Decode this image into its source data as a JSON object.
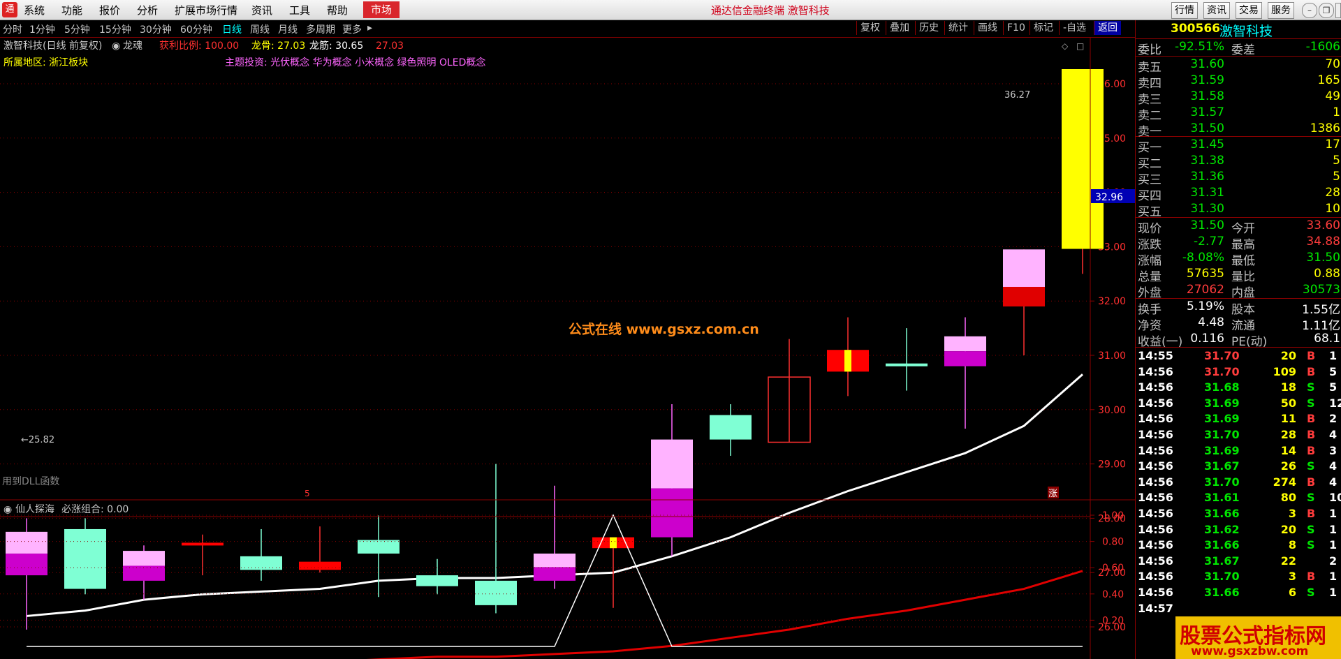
{
  "menu": {
    "logo": "通",
    "items": [
      "系统",
      "功能",
      "报价",
      "分析",
      "扩展市场行情",
      "资讯",
      "工具",
      "帮助"
    ],
    "market_tab": "市场",
    "app_title": "通达信金融终端  激智科技",
    "right_buttons": [
      "行情",
      "资讯",
      "交易",
      "服务"
    ]
  },
  "periods": [
    "分时",
    "1分钟",
    "5分钟",
    "15分钟",
    "30分钟",
    "60分钟",
    "日线",
    "周线",
    "月线",
    "多周期",
    "更多"
  ],
  "tools": [
    "复权",
    "叠加",
    "历史",
    "统计",
    "画线",
    "F10",
    "标记",
    "-自选",
    "返回"
  ],
  "chart_header": {
    "name": "激智科技(日线 前复权)",
    "indicator": "龙魂",
    "profit_label": "获利比例: 100.00",
    "longgu": "龙骨: 27.03",
    "longjin": "龙筋: 30.65",
    "extra": "27.03",
    "region": "所属地区: 浙江板块",
    "theme": "主题投资: 光伏概念 华为概念 小米概念 绿色照明 OLED概念",
    "dll_note": "用到DLL函数",
    "watermark": "公式在线 www.gsxz.com.cn",
    "high_label": "36.27",
    "low_label": "←25.82",
    "marker_5": "5",
    "marker_zhang": "涨",
    "current_price_tag": "32.96"
  },
  "sub_header": {
    "name": "仙人探海",
    "value_label": "必涨组合: 0.00"
  },
  "chart_data": [
    {
      "type": "candlestick",
      "title": "激智科技(日线 前复权)",
      "y_ticks": [
        "36.00",
        "35.00",
        "34.00",
        "33.00",
        "32.00",
        "31.00",
        "30.00",
        "29.00",
        "28.00",
        "27.00",
        "26.00"
      ],
      "ylim": [
        25.0,
        36.5
      ],
      "candles": [
        {
          "o": 27.75,
          "h": 28.0,
          "l": 25.95,
          "c": 26.95,
          "style": "pink"
        },
        {
          "o": 26.7,
          "h": 28.0,
          "l": 26.6,
          "c": 27.8,
          "style": "cyan"
        },
        {
          "o": 27.4,
          "h": 27.5,
          "l": 26.5,
          "c": 26.85,
          "style": "pink"
        },
        {
          "o": 27.55,
          "h": 27.7,
          "l": 26.95,
          "c": 27.55,
          "style": "red"
        },
        {
          "o": 27.05,
          "h": 27.8,
          "l": 26.85,
          "c": 27.3,
          "style": "cyan"
        },
        {
          "o": 27.2,
          "h": 27.85,
          "l": 27.0,
          "c": 27.05,
          "style": "red"
        },
        {
          "o": 27.35,
          "h": 28.05,
          "l": 26.55,
          "c": 27.6,
          "style": "cyan"
        },
        {
          "o": 26.75,
          "h": 27.25,
          "l": 26.6,
          "c": 26.95,
          "style": "cyan"
        },
        {
          "o": 26.4,
          "h": 29.0,
          "l": 26.25,
          "c": 26.85,
          "style": "cyan"
        },
        {
          "o": 27.35,
          "h": 28.6,
          "l": 26.7,
          "c": 26.85,
          "style": "pink"
        },
        {
          "o": 27.65,
          "h": 27.65,
          "l": 26.35,
          "c": 27.45,
          "style": "red"
        },
        {
          "o": 29.45,
          "h": 30.1,
          "l": 27.3,
          "c": 27.65,
          "style": "pink"
        },
        {
          "o": 29.45,
          "h": 30.1,
          "l": 29.15,
          "c": 29.9,
          "style": "cyan"
        },
        {
          "o": 29.4,
          "h": 31.3,
          "l": 29.4,
          "c": 30.6,
          "style": "red"
        },
        {
          "o": 31.1,
          "h": 31.7,
          "l": 30.25,
          "c": 30.7,
          "style": "red"
        },
        {
          "o": 30.8,
          "h": 31.5,
          "l": 30.35,
          "c": 30.85,
          "style": "cyan"
        },
        {
          "o": 31.35,
          "h": 31.7,
          "l": 29.65,
          "c": 30.8,
          "style": "pink"
        },
        {
          "o": 32.95,
          "h": 32.95,
          "l": 31.0,
          "c": 31.9,
          "style": "red"
        },
        {
          "o": 32.96,
          "h": 36.27,
          "l": 32.5,
          "c": 36.27,
          "style": "yellow"
        }
      ],
      "series": [
        {
          "name": "龙骨",
          "color": "#ffffff",
          "values": [
            26.2,
            26.3,
            26.5,
            26.6,
            26.65,
            26.7,
            26.85,
            26.9,
            26.9,
            26.95,
            27.0,
            27.3,
            27.65,
            28.1,
            28.5,
            28.85,
            29.2,
            29.7,
            30.65
          ]
        },
        {
          "name": "",
          "color": "#e00000",
          "values": [
            25.0,
            25.1,
            25.2,
            25.25,
            25.3,
            25.35,
            25.4,
            25.45,
            25.45,
            25.5,
            25.55,
            25.65,
            25.8,
            25.95,
            26.15,
            26.3,
            26.5,
            26.7,
            27.03
          ]
        }
      ]
    },
    {
      "type": "line",
      "title": "仙人探海",
      "y_ticks": [
        "1.00",
        "0.80",
        "0.60",
        "0.40",
        "0.20"
      ],
      "ylim": [
        0,
        1.05
      ],
      "series": [
        {
          "name": "必涨组合",
          "values": [
            0,
            0,
            0,
            0,
            0,
            0,
            0,
            0,
            0,
            0,
            1,
            0,
            0,
            0,
            0,
            0,
            0,
            0,
            0
          ]
        }
      ]
    }
  ],
  "quote": {
    "code": "300566",
    "name": "激智科技",
    "weibi_label": "委比",
    "weibi": "-92.51%",
    "weicha_label": "委差",
    "weicha": "-1606",
    "asks": [
      {
        "label": "卖五",
        "price": "31.60",
        "vol": "70"
      },
      {
        "label": "卖四",
        "price": "31.59",
        "vol": "165"
      },
      {
        "label": "卖三",
        "price": "31.58",
        "vol": "49"
      },
      {
        "label": "卖二",
        "price": "31.57",
        "vol": "1"
      },
      {
        "label": "卖一",
        "price": "31.50",
        "vol": "1386"
      }
    ],
    "bids": [
      {
        "label": "买一",
        "price": "31.45",
        "vol": "17"
      },
      {
        "label": "买二",
        "price": "31.38",
        "vol": "5"
      },
      {
        "label": "买三",
        "price": "31.36",
        "vol": "5"
      },
      {
        "label": "买四",
        "price": "31.31",
        "vol": "28"
      },
      {
        "label": "买五",
        "price": "31.30",
        "vol": "10"
      }
    ],
    "stats1": [
      {
        "l1": "现价",
        "v1": "31.50",
        "c1": "green",
        "l2": "今开",
        "v2": "33.60",
        "c2": "red"
      },
      {
        "l1": "涨跌",
        "v1": "-2.77",
        "c1": "green",
        "l2": "最高",
        "v2": "34.88",
        "c2": "red"
      },
      {
        "l1": "涨幅",
        "v1": "-8.08%",
        "c1": "green",
        "l2": "最低",
        "v2": "31.50",
        "c2": "green"
      },
      {
        "l1": "总量",
        "v1": "57635",
        "c1": "yellow",
        "l2": "量比",
        "v2": "0.88",
        "c2": "yellow"
      },
      {
        "l1": "外盘",
        "v1": "27062",
        "c1": "red",
        "l2": "内盘",
        "v2": "30573",
        "c2": "green"
      }
    ],
    "stats2": [
      {
        "l1": "换手",
        "v1": "5.19%",
        "l2": "股本",
        "v2": "1.55亿"
      },
      {
        "l1": "净资",
        "v1": "4.48",
        "l2": "流通",
        "v2": "1.11亿"
      },
      {
        "l1": "收益(一)",
        "v1": "0.116",
        "l2": "PE(动)",
        "v2": "68.1"
      }
    ],
    "ticks": [
      {
        "t": "14:55",
        "p": "31.70",
        "pc": "red",
        "v": "20",
        "bs": "B",
        "n": "1"
      },
      {
        "t": "14:56",
        "p": "31.70",
        "pc": "red",
        "v": "109",
        "bs": "B",
        "n": "5"
      },
      {
        "t": "14:56",
        "p": "31.68",
        "pc": "green",
        "v": "18",
        "bs": "S",
        "n": "5"
      },
      {
        "t": "14:56",
        "p": "31.69",
        "pc": "green",
        "v": "50",
        "bs": "S",
        "n": "12"
      },
      {
        "t": "14:56",
        "p": "31.69",
        "pc": "green",
        "v": "11",
        "bs": "B",
        "n": "2"
      },
      {
        "t": "14:56",
        "p": "31.70",
        "pc": "green",
        "v": "28",
        "bs": "B",
        "n": "4"
      },
      {
        "t": "14:56",
        "p": "31.69",
        "pc": "green",
        "v": "14",
        "bs": "B",
        "n": "3"
      },
      {
        "t": "14:56",
        "p": "31.67",
        "pc": "green",
        "v": "26",
        "bs": "S",
        "n": "4"
      },
      {
        "t": "14:56",
        "p": "31.70",
        "pc": "green",
        "v": "274",
        "bs": "B",
        "n": "4"
      },
      {
        "t": "14:56",
        "p": "31.61",
        "pc": "green",
        "v": "80",
        "bs": "S",
        "n": "10"
      },
      {
        "t": "14:56",
        "p": "31.66",
        "pc": "green",
        "v": "3",
        "bs": "B",
        "n": "1"
      },
      {
        "t": "14:56",
        "p": "31.62",
        "pc": "green",
        "v": "20",
        "bs": "S",
        "n": "1"
      },
      {
        "t": "14:56",
        "p": "31.66",
        "pc": "green",
        "v": "8",
        "bs": "S",
        "n": "1"
      },
      {
        "t": "14:56",
        "p": "31.67",
        "pc": "green",
        "v": "22",
        "bs": "",
        "n": "2"
      },
      {
        "t": "14:56",
        "p": "31.70",
        "pc": "green",
        "v": "3",
        "bs": "B",
        "n": "1"
      },
      {
        "t": "14:56",
        "p": "31.66",
        "pc": "green",
        "v": "6",
        "bs": "S",
        "n": "1"
      },
      {
        "t": "14:57",
        "p": "",
        "pc": "green",
        "v": "",
        "bs": "",
        "n": ""
      }
    ]
  },
  "watermark_br": {
    "line1": "股票公式指标网",
    "line2": "www.gsxzbw.com"
  }
}
